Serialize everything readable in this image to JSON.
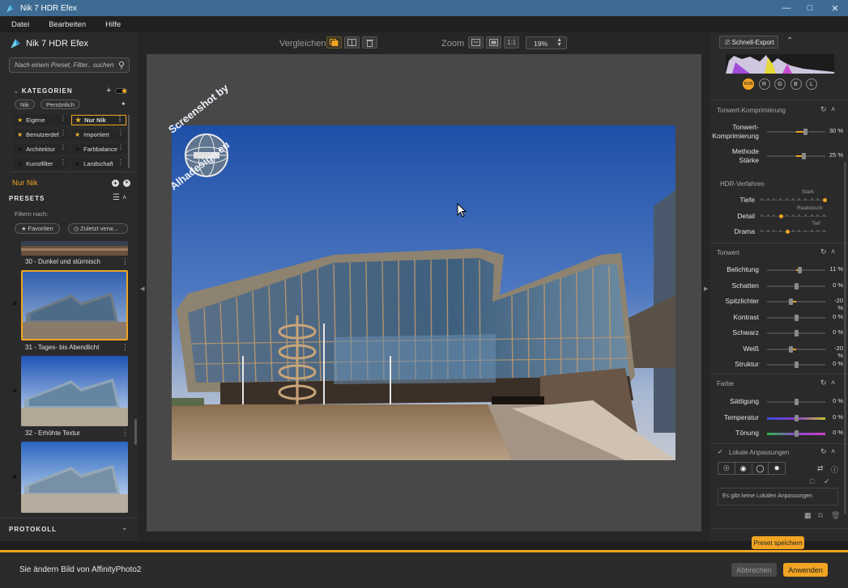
{
  "window": {
    "title": "Nik 7 HDR Efex"
  },
  "menu": [
    "Datei",
    "Bearbeiten",
    "Hilfe"
  ],
  "left": {
    "brand": "Nik 7 HDR Efex",
    "search_placeholder": "Nach einem Preset, Filter.. suchen",
    "categories_title": "KATEGORIEN",
    "filter_chips": [
      "Nik",
      "Persönlich"
    ],
    "categories": [
      {
        "label": "Eigene",
        "star": "gold"
      },
      {
        "label": "Nur Nik",
        "star": "gold",
        "active": true
      },
      {
        "label": "Benutzerdef.",
        "star": "gold"
      },
      {
        "label": "Importiert",
        "star": "gold"
      },
      {
        "label": "Architektur",
        "star": "dark"
      },
      {
        "label": "Farbbalance",
        "star": "dark"
      },
      {
        "label": "Kunstfilter",
        "star": "dark"
      },
      {
        "label": "Landschaft",
        "star": "dark"
      }
    ],
    "current_category": "Nur Nik",
    "presets_title": "PRESETS",
    "filter_by": "Filtern nach:",
    "filter_buttons": [
      "Favoriten",
      "Zuletzt verw..."
    ],
    "presets": [
      {
        "label": "30 - Dunkel und stürmisch"
      },
      {
        "label": "31 - Tages- bis Abendlicht",
        "selected": true
      },
      {
        "label": "32 - Erhöhte Textur"
      }
    ],
    "protokoll_title": "PROTOKOLL"
  },
  "toolbar": {
    "compare_label": "Vergleichen",
    "zoom_label": "Zoom",
    "zoom_ratio": "1:1",
    "zoom_value": "19%"
  },
  "watermark": {
    "line1": "Screenshot by",
    "line2": "Alhadesign.eu"
  },
  "right": {
    "export_label": "Schnell-Export",
    "channels": [
      "RGB",
      "R",
      "G",
      "B",
      "L"
    ],
    "tone_compression": {
      "title": "Tonwert-Komprimierung",
      "rows": [
        {
          "label1": "Tonwert-",
          "label2": "Komprimierung",
          "value": "30 %",
          "pct": 30
        },
        {
          "label1": "Methode",
          "label2": "Stärke",
          "value": "25 %",
          "pct": 25
        }
      ]
    },
    "hdr": {
      "title": "HDR-Verfahren",
      "rows": [
        {
          "label": "Tiefe",
          "hint": "Stark"
        },
        {
          "label": "Detail",
          "hint": "Realistisch"
        },
        {
          "label": "Drama",
          "hint": "Tief"
        }
      ]
    },
    "tonwert": {
      "title": "Tonwert",
      "rows": [
        {
          "label": "Belichtung",
          "value": "11 %",
          "pct": 11
        },
        {
          "label": "Schatten",
          "value": "0 %",
          "pct": 0
        },
        {
          "label": "Spitzlichter",
          "value": "-20 %",
          "pct": -20
        },
        {
          "label": "Kontrast",
          "value": "0 %",
          "pct": 0
        },
        {
          "label": "Schwarz",
          "value": "0 %",
          "pct": 0
        },
        {
          "label": "Weiß",
          "value": "-20 %",
          "pct": -20
        },
        {
          "label": "Struktur",
          "value": "0 %",
          "pct": 0
        }
      ]
    },
    "farbe": {
      "title": "Farbe",
      "rows": [
        {
          "label": "Sättigung",
          "value": "0 %",
          "pct": 0
        },
        {
          "label": "Temperatur",
          "value": "0 %",
          "pct": 0
        },
        {
          "label": "Tönung",
          "value": "0 %",
          "pct": 0
        }
      ]
    },
    "local": {
      "title": "Lokale Anpassungen",
      "empty": "Es gibt keine Lokalen Anpassungen"
    },
    "save_preset": "Preset speichern"
  },
  "footer": {
    "message": "Sie ändern Bild von AffinityPhoto2",
    "cancel": "Abbrechen",
    "apply": "Anwenden"
  },
  "colors": {
    "accent": "#f0a422",
    "titlebar": "#3d6b93"
  }
}
